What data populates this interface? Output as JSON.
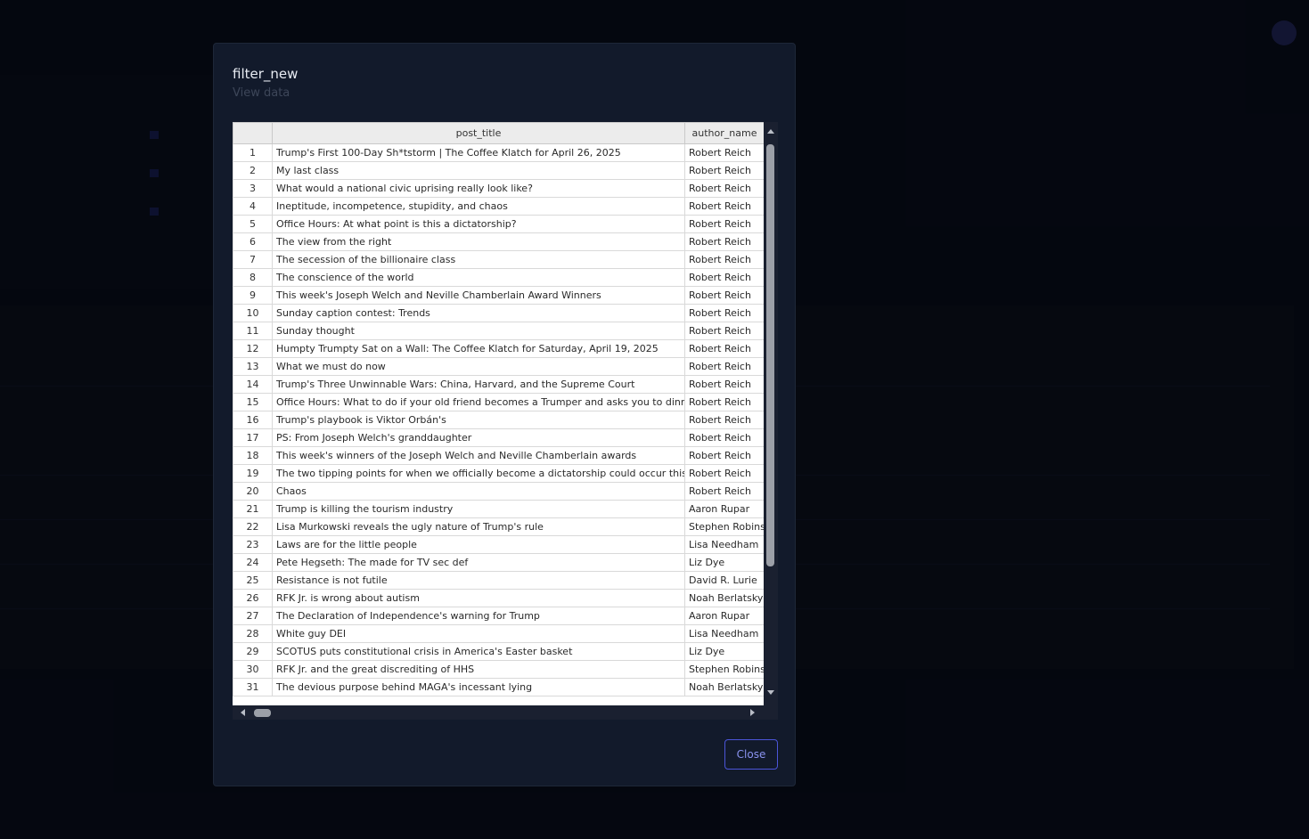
{
  "modal": {
    "title": "filter_new",
    "subtitle": "View data",
    "close_label": "Close"
  },
  "table": {
    "columns": [
      "",
      "post_title",
      "author_name"
    ],
    "rows": [
      {
        "index": "1",
        "post_title": "Trump's First 100-Day Sh*tstorm | The Coffee Klatch for April 26, 2025",
        "author_name": "Robert Reich"
      },
      {
        "index": "2",
        "post_title": "My last class",
        "author_name": "Robert Reich"
      },
      {
        "index": "3",
        "post_title": "What would a national civic uprising really look like?",
        "author_name": "Robert Reich"
      },
      {
        "index": "4",
        "post_title": "Ineptitude, incompetence, stupidity, and chaos",
        "author_name": "Robert Reich"
      },
      {
        "index": "5",
        "post_title": "Office Hours: At what point is this a dictatorship?",
        "author_name": "Robert Reich"
      },
      {
        "index": "6",
        "post_title": "The view from the right",
        "author_name": "Robert Reich"
      },
      {
        "index": "7",
        "post_title": "The secession of the billionaire class",
        "author_name": "Robert Reich"
      },
      {
        "index": "8",
        "post_title": "The conscience of the world",
        "author_name": "Robert Reich"
      },
      {
        "index": "9",
        "post_title": "This week's Joseph Welch and Neville Chamberlain Award Winners",
        "author_name": "Robert Reich"
      },
      {
        "index": "10",
        "post_title": "Sunday caption contest: Trends",
        "author_name": "Robert Reich"
      },
      {
        "index": "11",
        "post_title": "Sunday thought",
        "author_name": "Robert Reich"
      },
      {
        "index": "12",
        "post_title": "Humpty Trumpty Sat on a Wall: The Coffee Klatch for Saturday, April 19, 2025",
        "author_name": "Robert Reich"
      },
      {
        "index": "13",
        "post_title": "What we must do now",
        "author_name": "Robert Reich"
      },
      {
        "index": "14",
        "post_title": "Trump's Three Unwinnable Wars: China, Harvard, and the Supreme Court",
        "author_name": "Robert Reich"
      },
      {
        "index": "15",
        "post_title": "Office Hours: What to do if your old friend becomes a Trumper and asks you to dinner?",
        "author_name": "Robert Reich"
      },
      {
        "index": "16",
        "post_title": "Trump's playbook is Viktor Orbán's",
        "author_name": "Robert Reich"
      },
      {
        "index": "17",
        "post_title": "PS: From Joseph Welch's granddaughter",
        "author_name": "Robert Reich"
      },
      {
        "index": "18",
        "post_title": "This week's winners of the Joseph Welch and Neville Chamberlain awards",
        "author_name": "Robert Reich"
      },
      {
        "index": "19",
        "post_title": "The two tipping points for when we officially become a dictatorship could occur this week",
        "author_name": "Robert Reich"
      },
      {
        "index": "20",
        "post_title": "Chaos",
        "author_name": "Robert Reich"
      },
      {
        "index": "21",
        "post_title": "Trump is killing the tourism industry",
        "author_name": "Aaron Rupar"
      },
      {
        "index": "22",
        "post_title": "Lisa Murkowski reveals the ugly nature of Trump's rule",
        "author_name": "Stephen Robinson"
      },
      {
        "index": "23",
        "post_title": "Laws are for the little people",
        "author_name": "Lisa Needham"
      },
      {
        "index": "24",
        "post_title": "Pete Hegseth: The made for TV sec def",
        "author_name": "Liz Dye"
      },
      {
        "index": "25",
        "post_title": "Resistance is not futile",
        "author_name": "David R. Lurie"
      },
      {
        "index": "26",
        "post_title": "RFK Jr. is wrong about autism",
        "author_name": "Noah Berlatsky"
      },
      {
        "index": "27",
        "post_title": "The Declaration of Independence's warning for Trump",
        "author_name": "Aaron Rupar"
      },
      {
        "index": "28",
        "post_title": "White guy DEI",
        "author_name": "Lisa Needham"
      },
      {
        "index": "29",
        "post_title": "SCOTUS puts constitutional crisis in America's Easter basket",
        "author_name": "Liz Dye"
      },
      {
        "index": "30",
        "post_title": "RFK Jr. and the great discrediting of HHS",
        "author_name": "Stephen Robinson"
      },
      {
        "index": "31",
        "post_title": "The devious purpose behind MAGA's incessant lying",
        "author_name": "Noah Berlatsky"
      }
    ]
  },
  "colors": {
    "accent": "#4b55d8",
    "modal_bg": "#121a2b",
    "page_bg": "#03050d"
  }
}
